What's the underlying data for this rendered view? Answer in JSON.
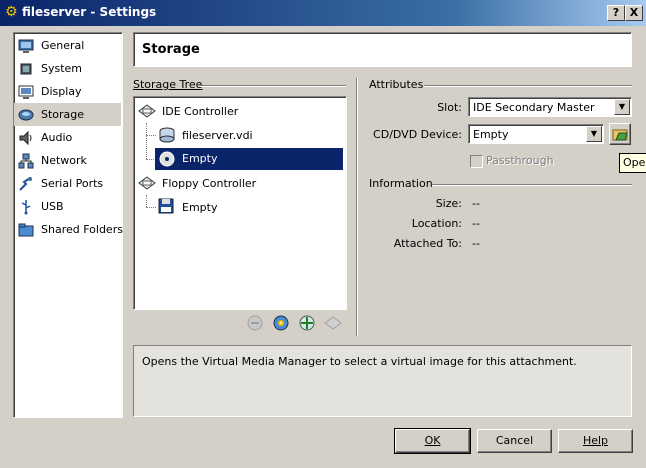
{
  "window": {
    "title": "fileserver - Settings",
    "help_btn": "?",
    "close_btn": "X"
  },
  "nav": {
    "items": [
      {
        "label": "General"
      },
      {
        "label": "System"
      },
      {
        "label": "Display"
      },
      {
        "label": "Storage"
      },
      {
        "label": "Audio"
      },
      {
        "label": "Network"
      },
      {
        "label": "Serial Ports"
      },
      {
        "label": "USB"
      },
      {
        "label": "Shared Folders"
      }
    ],
    "selected": "Storage"
  },
  "page": {
    "title": "Storage"
  },
  "storage_tree": {
    "heading": "Storage Tree",
    "ide_controller": "IDE Controller",
    "vdi": "fileserver.vdi",
    "ide_empty": "Empty",
    "floppy_controller": "Floppy Controller",
    "floppy_empty": "Empty"
  },
  "attributes": {
    "heading": "Attributes",
    "slot_label": "Slot:",
    "slot_value": "IDE Secondary Master",
    "cd_label": "CD/DVD Device:",
    "cd_value": "Empty",
    "passthrough_label": "Passthrough",
    "tooltip": "Oper"
  },
  "information": {
    "heading": "Information",
    "size_label": "Size:",
    "size_value": "--",
    "location_label": "Location:",
    "location_value": "--",
    "attached_label": "Attached To:",
    "attached_value": "--"
  },
  "description": "Opens the Virtual Media Manager to select a virtual image for this attachment.",
  "buttons": {
    "ok": "OK",
    "cancel": "Cancel",
    "help": "Help"
  }
}
